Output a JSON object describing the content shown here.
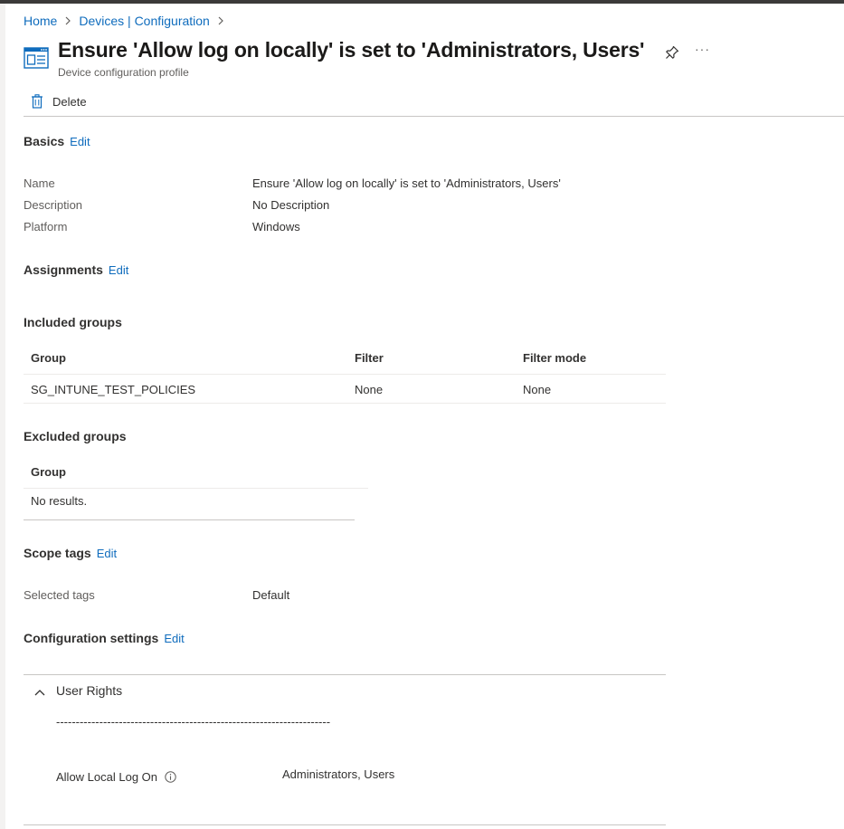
{
  "breadcrumb": {
    "items": [
      "Home",
      "Devices | Configuration"
    ]
  },
  "header": {
    "title": "Ensure 'Allow log on locally' is set to 'Administrators, Users'",
    "subtitle": "Device configuration profile",
    "icon": "profile-window-icon"
  },
  "toolbar": {
    "delete_label": "Delete"
  },
  "basics": {
    "title": "Basics",
    "edit_label": "Edit",
    "fields": [
      {
        "label": "Name",
        "value": "Ensure 'Allow log on locally' is set to 'Administrators, Users'"
      },
      {
        "label": "Description",
        "value": "No Description"
      },
      {
        "label": "Platform",
        "value": "Windows"
      }
    ]
  },
  "assignments": {
    "title": "Assignments",
    "edit_label": "Edit",
    "included": {
      "title": "Included groups",
      "columns": [
        "Group",
        "Filter",
        "Filter mode"
      ],
      "rows": [
        [
          "SG_INTUNE_TEST_POLICIES",
          "None",
          "None"
        ]
      ]
    },
    "excluded": {
      "title": "Excluded groups",
      "columns": [
        "Group"
      ],
      "empty_text": "No results."
    }
  },
  "scope_tags": {
    "title": "Scope tags",
    "edit_label": "Edit",
    "label": "Selected tags",
    "value": "Default"
  },
  "configuration": {
    "title": "Configuration settings",
    "edit_label": "Edit",
    "group": "User Rights",
    "divider_text": "----------------------------------------------------------------------",
    "setting_label": "Allow Local Log On",
    "setting_value": "Administrators, Users"
  },
  "colors": {
    "link": "#0f6cbd",
    "text": "#323130",
    "muted": "#605e5c"
  }
}
